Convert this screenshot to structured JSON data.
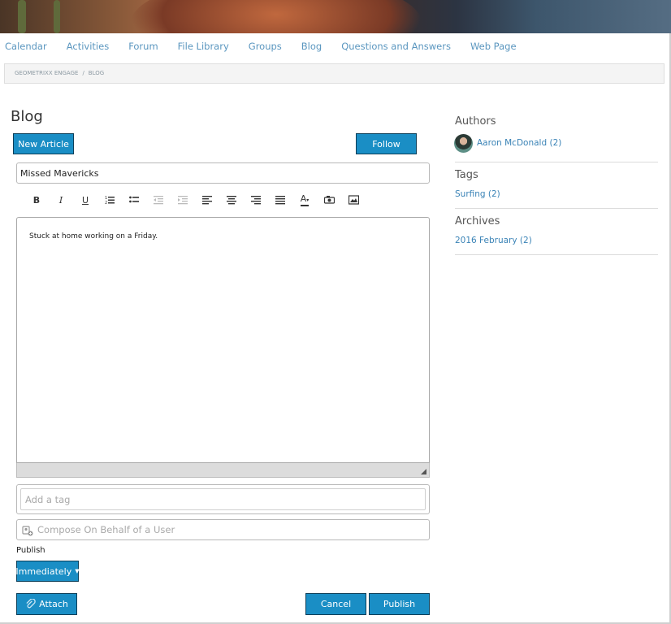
{
  "nav": {
    "items": [
      "Calendar",
      "Activities",
      "Forum",
      "File Library",
      "Groups",
      "Blog",
      "Questions and Answers",
      "Web Page"
    ]
  },
  "breadcrumb": {
    "items": [
      "GEOMETRIXX ENGAGE",
      "BLOG"
    ],
    "separator": "/"
  },
  "page": {
    "title": "Blog"
  },
  "actions": {
    "new_article": "New Article",
    "follow": "Follow"
  },
  "composer": {
    "title_value": "Missed Mavericks",
    "body_text": "Stuck at home working on a Friday.",
    "tag_placeholder": "Add a tag",
    "behalf_placeholder": "Compose On Behalf of a User",
    "publish_label": "Publish",
    "publish_option": "Immediately",
    "attach": "Attach",
    "cancel": "Cancel",
    "publish": "Publish"
  },
  "toolbar": {
    "buttons": [
      "bold",
      "italic",
      "underline",
      "ordered-list",
      "unordered-list",
      "outdent",
      "indent",
      "align-left",
      "align-center",
      "align-right",
      "justify",
      "text-color",
      "link",
      "image"
    ],
    "bold_glyph": "B",
    "italic_glyph": "I",
    "underline_glyph": "U",
    "color_glyph": "A"
  },
  "sidebar": {
    "authors_heading": "Authors",
    "author": "Aaron McDonald (2)",
    "tags_heading": "Tags",
    "tag": "Surfing (2)",
    "archives_heading": "Archives",
    "archive": "2016 February (2)"
  },
  "colors": {
    "accent": "#1a8ec5",
    "link": "#3a83b6",
    "nav": "#5a96bf"
  }
}
